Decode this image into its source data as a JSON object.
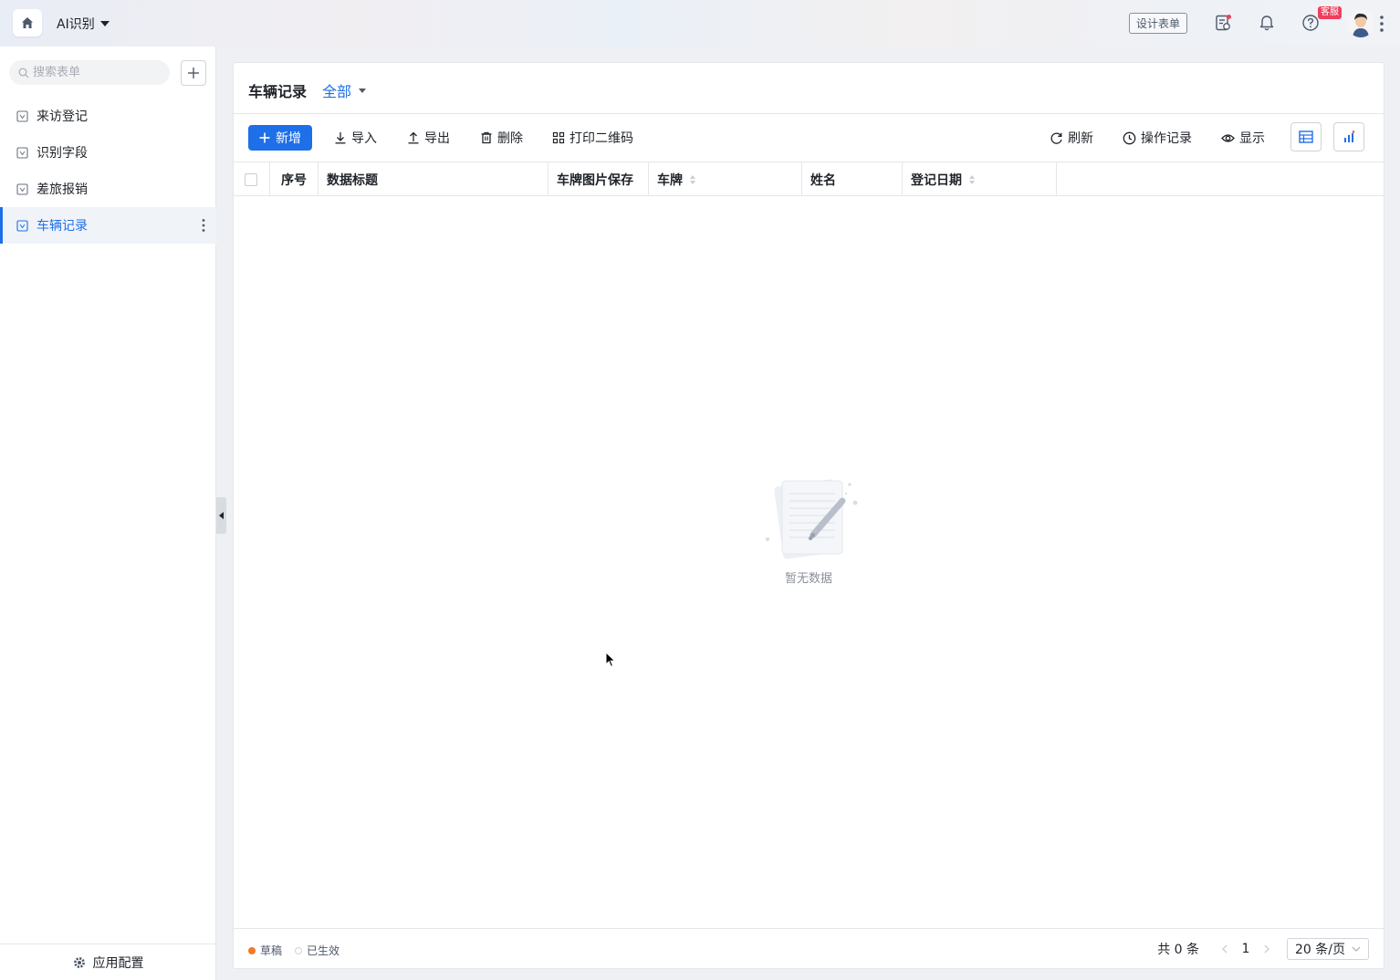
{
  "topbar": {
    "app_title": "AI识别",
    "design_button": "设计表单",
    "support_badge": "客服"
  },
  "sidebar": {
    "search_placeholder": "搜索表单",
    "items": [
      {
        "label": "来访登记",
        "active": false
      },
      {
        "label": "识别字段",
        "active": false
      },
      {
        "label": "差旅报销",
        "active": false
      },
      {
        "label": "车辆记录",
        "active": true
      }
    ],
    "footer_label": "应用配置"
  },
  "main": {
    "title": "车辆记录",
    "view": "全部",
    "toolbar": {
      "add": "新增",
      "import": "导入",
      "export": "导出",
      "delete": "删除",
      "print_qr": "打印二维码",
      "refresh": "刷新",
      "history": "操作记录",
      "display": "显示"
    },
    "columns": [
      "序号",
      "数据标题",
      "车牌图片保存",
      "车牌",
      "姓名",
      "登记日期"
    ],
    "empty_text": "暂无数据",
    "legend": {
      "draft": "草稿",
      "effective": "已生效"
    },
    "pager": {
      "total": "共 0 条",
      "page": "1",
      "page_size": "20 条/页"
    }
  },
  "colors": {
    "primary": "#1e6fe8",
    "draft_dot": "#f07a2c",
    "badge": "#f03f5c"
  }
}
